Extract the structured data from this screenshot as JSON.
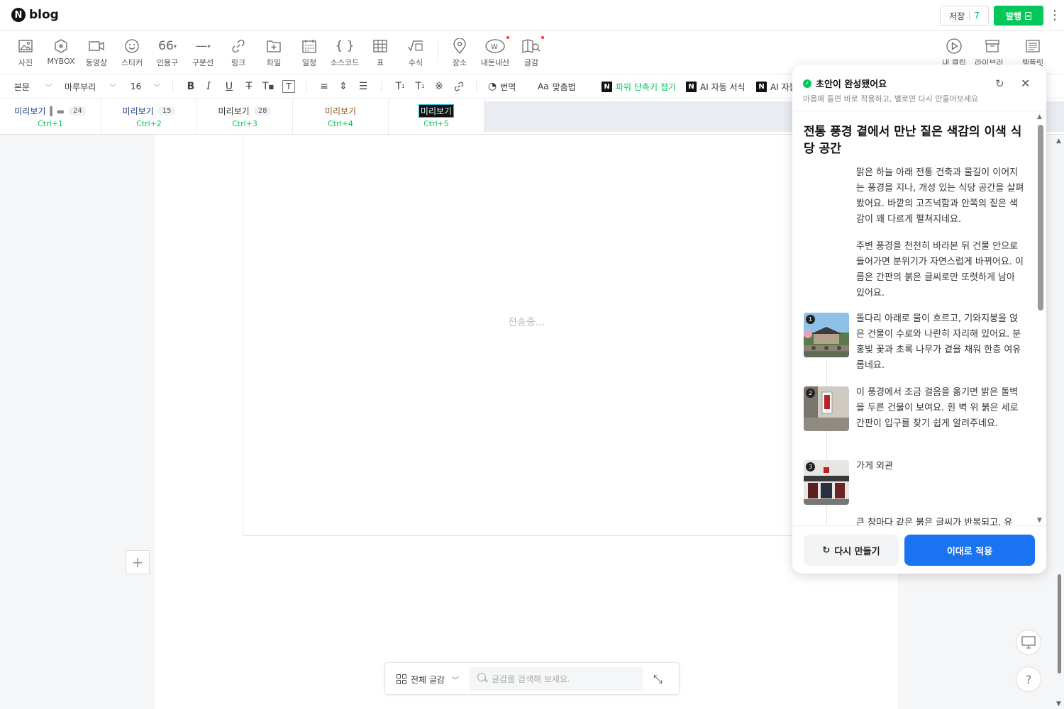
{
  "header": {
    "logo_letter": "N",
    "logo_text": "blog",
    "save_label": "저장",
    "save_count": "7",
    "publish_label": "발행"
  },
  "insert_toolbar": {
    "items": [
      {
        "label": "사진",
        "icon": "photo-icon"
      },
      {
        "label": "MYBOX",
        "icon": "mybox-icon"
      },
      {
        "label": "동영상",
        "icon": "video-icon"
      },
      {
        "label": "스티커",
        "icon": "sticker-icon"
      },
      {
        "label": "인용구",
        "icon": "quote-icon"
      },
      {
        "label": "구분선",
        "icon": "divider-icon"
      },
      {
        "label": "링크",
        "icon": "link-icon"
      },
      {
        "label": "파일",
        "icon": "file-icon"
      },
      {
        "label": "일정",
        "icon": "calendar-icon"
      },
      {
        "label": "소스코드",
        "icon": "code-icon"
      },
      {
        "label": "표",
        "icon": "table-icon"
      },
      {
        "label": "수식",
        "icon": "formula-icon"
      },
      {
        "label": "장소",
        "icon": "place-icon"
      },
      {
        "label": "내돈내산",
        "icon": "wallet-icon"
      },
      {
        "label": "글감",
        "icon": "material-icon"
      }
    ],
    "right_items": [
      {
        "label": "내 클립",
        "icon": "clip-icon"
      },
      {
        "label": "라이브러리",
        "icon": "library-icon"
      },
      {
        "label": "템플릿",
        "icon": "template-icon"
      }
    ]
  },
  "format_toolbar": {
    "style": "본문",
    "font": "마루부리",
    "size": "16",
    "translate_label": "번역",
    "spell_label": "맞춤법",
    "power_label": "파워 단축키 접기",
    "ai_format_label": "AI 자동 서식",
    "ai_more_label": "AI 자동"
  },
  "preview_bar": {
    "items": [
      {
        "label": "미리보기",
        "count": "24",
        "shortcut": "Ctrl+1"
      },
      {
        "label": "미리보기",
        "count": "15",
        "shortcut": "Ctrl+2"
      },
      {
        "label": "미리보기",
        "count": "28",
        "shortcut": "Ctrl+3"
      },
      {
        "label": "미리보기",
        "count": "",
        "shortcut": "Ctrl+4"
      },
      {
        "label": "미리보기",
        "count": "",
        "shortcut": "Ctrl+5"
      }
    ]
  },
  "editor": {
    "sending_text": "전송중..."
  },
  "bottom_bar": {
    "category": "전체 글감",
    "search_placeholder": "글감을 검색해 보세요."
  },
  "ai_panel": {
    "title": "초안이 완성됐어요",
    "subtitle": "마음에 들면 바로 적용하고, 별로면 다시 만들어보세요",
    "heading": "전통 풍경 곁에서 만난 짙은 색감의 이색 식당 공간",
    "paragraphs": [
      "맑은 하늘 아래 전통 건축과 물길이 이어지는 풍경을 지나, 개성 있는 식당 공간을 살펴봤어요. 바깥의 고즈넉함과 안쪽의 짙은 색감이 꽤 다르게 펼쳐지네요.",
      "주변 풍경을 천천히 바라본 뒤 건물 안으로 들어가면 분위기가 자연스럽게 바뀌어요. 이름은 간판의 붉은 글씨로만 또렷하게 남아 있어요."
    ],
    "images": [
      {
        "num": "1",
        "text": "돌다리 아래로 물이 흐르고, 기와지붕을 얹은 건물이 수로와 나란히 자리해 있어요. 분홍빛 꽃과 초록 나무가 곁을 채워 한층 여유롭네요."
      },
      {
        "num": "2",
        "text": "이 풍경에서 조금 걸음을 옮기면 밝은 돌벽을 두른 건물이 보여요. 흰 벽 위 붉은 세로 간판이 입구를 찾기 쉽게 알려주네요."
      },
      {
        "num": "3",
        "text": "가게 외관"
      }
    ],
    "cut_text": "큰 창마다 같은 붉은 글씨가 반복되고, 유",
    "regen_label": "다시 만들기",
    "apply_label": "이대로 적용"
  },
  "colors": {
    "brand_green": "#03c75a",
    "apply_blue": "#1a73f0"
  }
}
